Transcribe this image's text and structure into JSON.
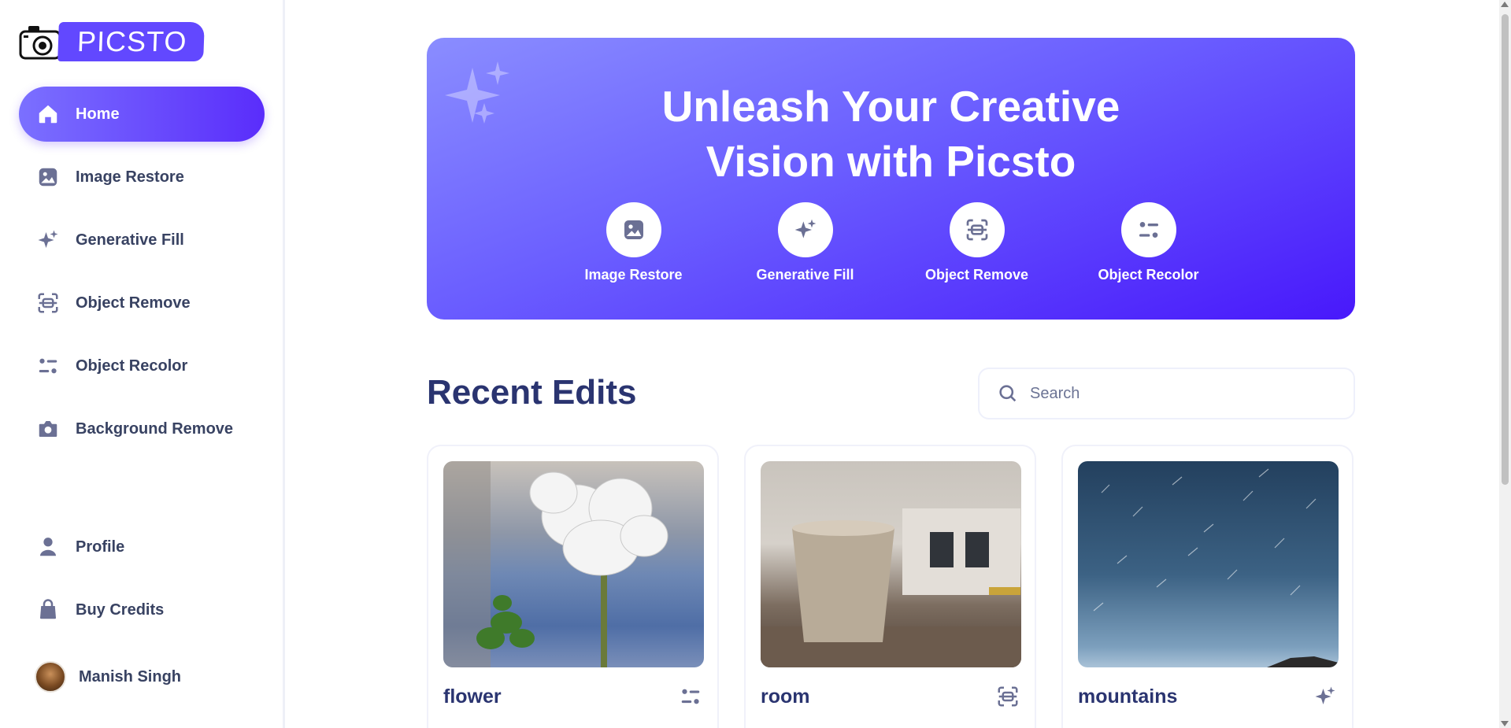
{
  "brand": {
    "name": "PICSTO",
    "accent": "#6248ff"
  },
  "sidebar": {
    "items": [
      {
        "label": "Home",
        "icon": "home-icon",
        "active": true
      },
      {
        "label": "Image Restore",
        "icon": "image-icon"
      },
      {
        "label": "Generative Fill",
        "icon": "sparkles-icon"
      },
      {
        "label": "Object Remove",
        "icon": "scan-icon"
      },
      {
        "label": "Object Recolor",
        "icon": "filter-icon"
      },
      {
        "label": "Background Remove",
        "icon": "camera-icon"
      }
    ],
    "bottom_items": [
      {
        "label": "Profile",
        "icon": "user-icon"
      },
      {
        "label": "Buy Credits",
        "icon": "bag-icon"
      }
    ],
    "user": {
      "name": "Manish Singh"
    }
  },
  "hero": {
    "title_line1": "Unleash Your Creative",
    "title_line2": "Vision with Picsto",
    "tools": [
      {
        "label": "Image Restore",
        "icon": "image-icon"
      },
      {
        "label": "Generative Fill",
        "icon": "sparkles-icon"
      },
      {
        "label": "Object Remove",
        "icon": "scan-icon"
      },
      {
        "label": "Object Recolor",
        "icon": "filter-icon"
      }
    ]
  },
  "recent": {
    "title": "Recent Edits",
    "search_placeholder": "Search",
    "cards": [
      {
        "name": "flower",
        "icon": "filter-icon"
      },
      {
        "name": "room",
        "icon": "scan-icon"
      },
      {
        "name": "mountains",
        "icon": "sparkles-icon"
      }
    ]
  }
}
